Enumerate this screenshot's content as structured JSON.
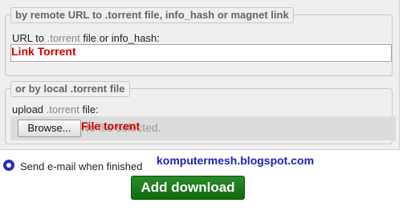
{
  "remote": {
    "legend": "by remote URL to .torrent file, info_hash or magnet link",
    "label_pre": "URL to ",
    "label_hl": ".torrent",
    "label_post": " file or info_hash:",
    "input_value": "",
    "overlay_text": "Link Torrent"
  },
  "local": {
    "legend": "or by local .torrent file",
    "label_pre": "upload ",
    "label_hl": ".torrent",
    "label_post": " file:",
    "browse_label": "Browse...",
    "no_file_text": "No file selected.",
    "overlay_text": "File torrent"
  },
  "email": {
    "label": "Send e-mail when finished",
    "checked": true,
    "check_color": "#2a2fbd"
  },
  "watermark": "komputermesh.blogspot.com",
  "submit": {
    "label": "Add download",
    "color": "#1a7a1a"
  },
  "colors": {
    "overlay_red": "#d40000",
    "panel_bg": "#efefef"
  }
}
